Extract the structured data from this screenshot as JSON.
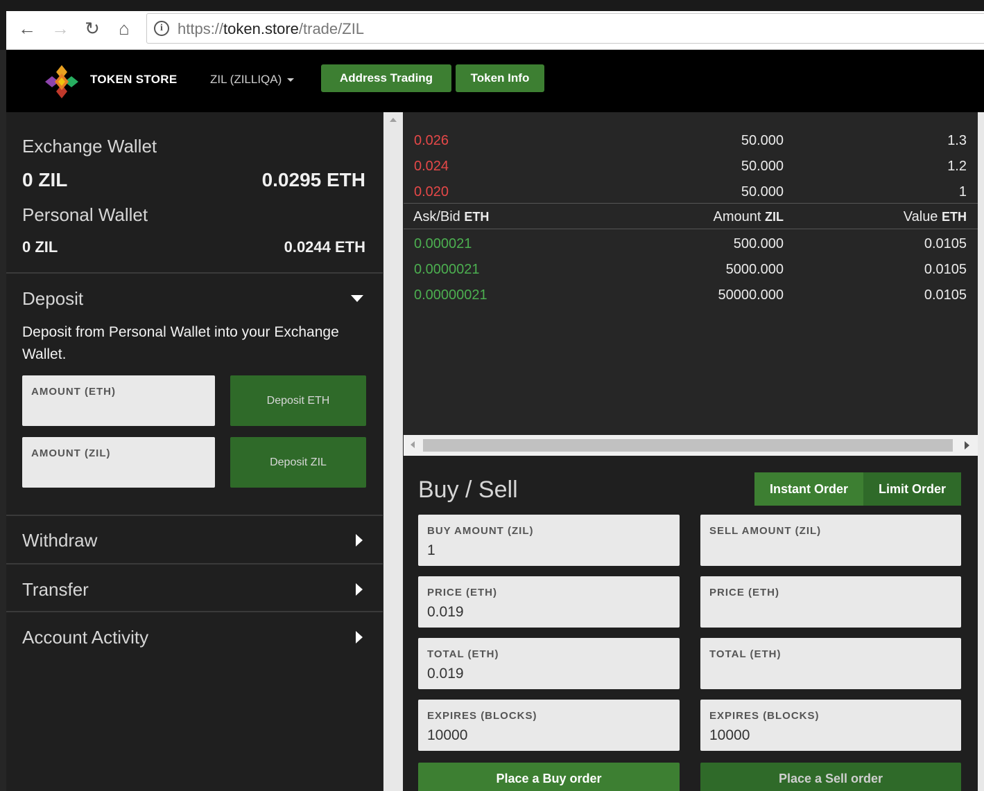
{
  "browser": {
    "back_icon": "←",
    "forward_icon": "→",
    "reload_icon": "↻",
    "home_icon": "⌂",
    "info_icon": "i",
    "url_scheme": "https://",
    "url_host": "token.store",
    "url_path": "/trade/ZIL"
  },
  "header": {
    "brand": "TOKEN STORE",
    "token_selector": "ZIL (ZILLIQA)",
    "address_trading": "Address Trading",
    "token_info": "Token Info"
  },
  "wallets": {
    "exchange_title": "Exchange Wallet",
    "exchange_token": "0 ZIL",
    "exchange_eth": "0.0295 ETH",
    "personal_title": "Personal Wallet",
    "personal_token": "0 ZIL",
    "personal_eth": "0.0244 ETH"
  },
  "deposit": {
    "title": "Deposit",
    "description": "Deposit from Personal Wallet into your Exchange Wallet.",
    "amount_eth_label": "AMOUNT (ETH)",
    "deposit_eth_button": "Deposit ETH",
    "amount_zil_label": "AMOUNT (ZIL)",
    "deposit_zil_button": "Deposit ZIL"
  },
  "sections": {
    "withdraw": "Withdraw",
    "transfer": "Transfer",
    "account_activity": "Account Activity"
  },
  "orderbook": {
    "asks": [
      {
        "price": "0.026",
        "amount": "50.000",
        "value": "1.3"
      },
      {
        "price": "0.024",
        "amount": "50.000",
        "value": "1.2"
      },
      {
        "price": "0.020",
        "amount": "50.000",
        "value": "1"
      }
    ],
    "header": {
      "price_label": "Ask/Bid",
      "price_unit": "ETH",
      "amount_label": "Amount",
      "amount_unit": "ZIL",
      "value_label": "Value",
      "value_unit": "ETH"
    },
    "bids": [
      {
        "price": "0.000021",
        "amount": "500.000",
        "value": "0.0105"
      },
      {
        "price": "0.0000021",
        "amount": "5000.000",
        "value": "0.0105"
      },
      {
        "price": "0.00000021",
        "amount": "50000.000",
        "value": "0.0105"
      }
    ]
  },
  "buysell": {
    "title": "Buy / Sell",
    "instant_order": "Instant Order",
    "limit_order": "Limit Order",
    "buy": {
      "amount_label": "BUY AMOUNT (ZIL)",
      "amount_value": "1",
      "price_label": "PRICE (ETH)",
      "price_value": "0.019",
      "total_label": "TOTAL (ETH)",
      "total_value": "0.019",
      "expires_label": "EXPIRES (BLOCKS)",
      "expires_value": "10000",
      "button": "Place a Buy order"
    },
    "sell": {
      "amount_label": "SELL AMOUNT (ZIL)",
      "amount_value": "",
      "price_label": "PRICE (ETH)",
      "price_value": "",
      "total_label": "TOTAL (ETH)",
      "total_value": "",
      "expires_label": "EXPIRES (BLOCKS)",
      "expires_value": "10000",
      "button": "Place a Sell order"
    }
  },
  "colors": {
    "accent_green": "#3d7f32",
    "ask_red": "#e54848",
    "bid_green": "#4caf50"
  }
}
